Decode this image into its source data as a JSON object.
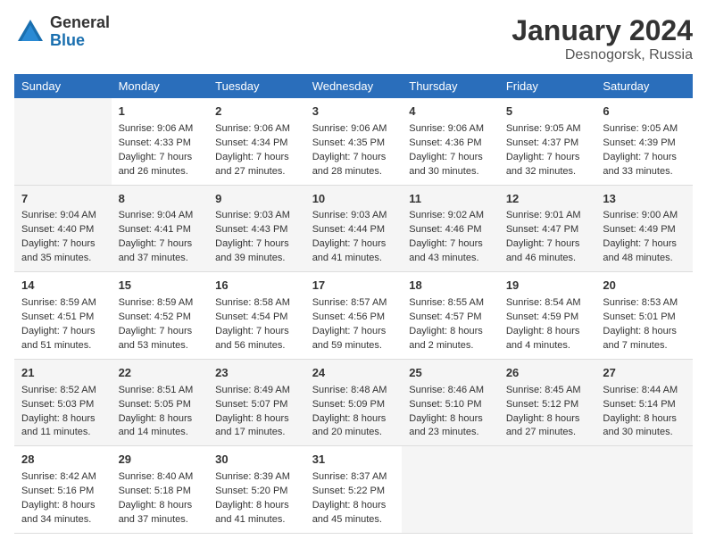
{
  "header": {
    "logo_general": "General",
    "logo_blue": "Blue",
    "title": "January 2024",
    "subtitle": "Desnogorsk, Russia"
  },
  "days_of_week": [
    "Sunday",
    "Monday",
    "Tuesday",
    "Wednesday",
    "Thursday",
    "Friday",
    "Saturday"
  ],
  "weeks": [
    [
      {
        "day": "",
        "sunrise": "",
        "sunset": "",
        "daylight": ""
      },
      {
        "day": "1",
        "sunrise": "Sunrise: 9:06 AM",
        "sunset": "Sunset: 4:33 PM",
        "daylight": "Daylight: 7 hours and 26 minutes."
      },
      {
        "day": "2",
        "sunrise": "Sunrise: 9:06 AM",
        "sunset": "Sunset: 4:34 PM",
        "daylight": "Daylight: 7 hours and 27 minutes."
      },
      {
        "day": "3",
        "sunrise": "Sunrise: 9:06 AM",
        "sunset": "Sunset: 4:35 PM",
        "daylight": "Daylight: 7 hours and 28 minutes."
      },
      {
        "day": "4",
        "sunrise": "Sunrise: 9:06 AM",
        "sunset": "Sunset: 4:36 PM",
        "daylight": "Daylight: 7 hours and 30 minutes."
      },
      {
        "day": "5",
        "sunrise": "Sunrise: 9:05 AM",
        "sunset": "Sunset: 4:37 PM",
        "daylight": "Daylight: 7 hours and 32 minutes."
      },
      {
        "day": "6",
        "sunrise": "Sunrise: 9:05 AM",
        "sunset": "Sunset: 4:39 PM",
        "daylight": "Daylight: 7 hours and 33 minutes."
      }
    ],
    [
      {
        "day": "7",
        "sunrise": "Sunrise: 9:04 AM",
        "sunset": "Sunset: 4:40 PM",
        "daylight": "Daylight: 7 hours and 35 minutes."
      },
      {
        "day": "8",
        "sunrise": "Sunrise: 9:04 AM",
        "sunset": "Sunset: 4:41 PM",
        "daylight": "Daylight: 7 hours and 37 minutes."
      },
      {
        "day": "9",
        "sunrise": "Sunrise: 9:03 AM",
        "sunset": "Sunset: 4:43 PM",
        "daylight": "Daylight: 7 hours and 39 minutes."
      },
      {
        "day": "10",
        "sunrise": "Sunrise: 9:03 AM",
        "sunset": "Sunset: 4:44 PM",
        "daylight": "Daylight: 7 hours and 41 minutes."
      },
      {
        "day": "11",
        "sunrise": "Sunrise: 9:02 AM",
        "sunset": "Sunset: 4:46 PM",
        "daylight": "Daylight: 7 hours and 43 minutes."
      },
      {
        "day": "12",
        "sunrise": "Sunrise: 9:01 AM",
        "sunset": "Sunset: 4:47 PM",
        "daylight": "Daylight: 7 hours and 46 minutes."
      },
      {
        "day": "13",
        "sunrise": "Sunrise: 9:00 AM",
        "sunset": "Sunset: 4:49 PM",
        "daylight": "Daylight: 7 hours and 48 minutes."
      }
    ],
    [
      {
        "day": "14",
        "sunrise": "Sunrise: 8:59 AM",
        "sunset": "Sunset: 4:51 PM",
        "daylight": "Daylight: 7 hours and 51 minutes."
      },
      {
        "day": "15",
        "sunrise": "Sunrise: 8:59 AM",
        "sunset": "Sunset: 4:52 PM",
        "daylight": "Daylight: 7 hours and 53 minutes."
      },
      {
        "day": "16",
        "sunrise": "Sunrise: 8:58 AM",
        "sunset": "Sunset: 4:54 PM",
        "daylight": "Daylight: 7 hours and 56 minutes."
      },
      {
        "day": "17",
        "sunrise": "Sunrise: 8:57 AM",
        "sunset": "Sunset: 4:56 PM",
        "daylight": "Daylight: 7 hours and 59 minutes."
      },
      {
        "day": "18",
        "sunrise": "Sunrise: 8:55 AM",
        "sunset": "Sunset: 4:57 PM",
        "daylight": "Daylight: 8 hours and 2 minutes."
      },
      {
        "day": "19",
        "sunrise": "Sunrise: 8:54 AM",
        "sunset": "Sunset: 4:59 PM",
        "daylight": "Daylight: 8 hours and 4 minutes."
      },
      {
        "day": "20",
        "sunrise": "Sunrise: 8:53 AM",
        "sunset": "Sunset: 5:01 PM",
        "daylight": "Daylight: 8 hours and 7 minutes."
      }
    ],
    [
      {
        "day": "21",
        "sunrise": "Sunrise: 8:52 AM",
        "sunset": "Sunset: 5:03 PM",
        "daylight": "Daylight: 8 hours and 11 minutes."
      },
      {
        "day": "22",
        "sunrise": "Sunrise: 8:51 AM",
        "sunset": "Sunset: 5:05 PM",
        "daylight": "Daylight: 8 hours and 14 minutes."
      },
      {
        "day": "23",
        "sunrise": "Sunrise: 8:49 AM",
        "sunset": "Sunset: 5:07 PM",
        "daylight": "Daylight: 8 hours and 17 minutes."
      },
      {
        "day": "24",
        "sunrise": "Sunrise: 8:48 AM",
        "sunset": "Sunset: 5:09 PM",
        "daylight": "Daylight: 8 hours and 20 minutes."
      },
      {
        "day": "25",
        "sunrise": "Sunrise: 8:46 AM",
        "sunset": "Sunset: 5:10 PM",
        "daylight": "Daylight: 8 hours and 23 minutes."
      },
      {
        "day": "26",
        "sunrise": "Sunrise: 8:45 AM",
        "sunset": "Sunset: 5:12 PM",
        "daylight": "Daylight: 8 hours and 27 minutes."
      },
      {
        "day": "27",
        "sunrise": "Sunrise: 8:44 AM",
        "sunset": "Sunset: 5:14 PM",
        "daylight": "Daylight: 8 hours and 30 minutes."
      }
    ],
    [
      {
        "day": "28",
        "sunrise": "Sunrise: 8:42 AM",
        "sunset": "Sunset: 5:16 PM",
        "daylight": "Daylight: 8 hours and 34 minutes."
      },
      {
        "day": "29",
        "sunrise": "Sunrise: 8:40 AM",
        "sunset": "Sunset: 5:18 PM",
        "daylight": "Daylight: 8 hours and 37 minutes."
      },
      {
        "day": "30",
        "sunrise": "Sunrise: 8:39 AM",
        "sunset": "Sunset: 5:20 PM",
        "daylight": "Daylight: 8 hours and 41 minutes."
      },
      {
        "day": "31",
        "sunrise": "Sunrise: 8:37 AM",
        "sunset": "Sunset: 5:22 PM",
        "daylight": "Daylight: 8 hours and 45 minutes."
      },
      {
        "day": "",
        "sunrise": "",
        "sunset": "",
        "daylight": ""
      },
      {
        "day": "",
        "sunrise": "",
        "sunset": "",
        "daylight": ""
      },
      {
        "day": "",
        "sunrise": "",
        "sunset": "",
        "daylight": ""
      }
    ]
  ]
}
